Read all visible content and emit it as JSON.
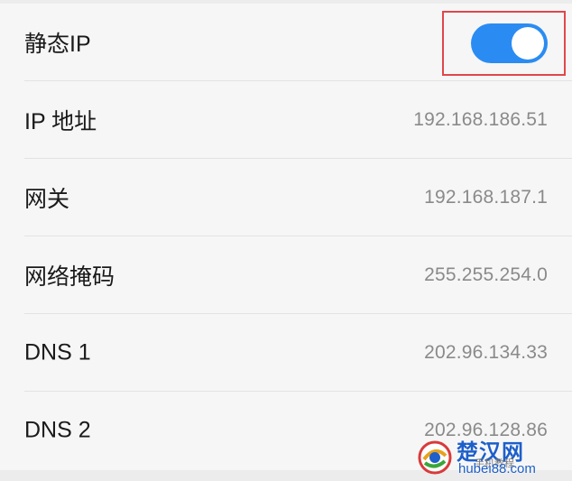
{
  "settings": {
    "rows": [
      {
        "label": "静态IP",
        "value": "",
        "type": "toggle",
        "toggle_on": true
      },
      {
        "label": "IP 地址",
        "value": "192.168.186.51"
      },
      {
        "label": "网关",
        "value": "192.168.187.1"
      },
      {
        "label": "网络掩码",
        "value": "255.255.254.0"
      },
      {
        "label": "DNS 1",
        "value": "202.96.134.33"
      },
      {
        "label": "DNS 2",
        "value": "202.96.128.86"
      }
    ]
  },
  "colors": {
    "toggle_on": "#2a8cf2",
    "highlight_box": "#e0474c",
    "label_text": "#1a1a1a",
    "value_text": "#8a8a8a",
    "background": "#f6f6f6"
  },
  "watermark": {
    "title": "楚汉网",
    "subtitle": "hubei88.com",
    "tag": "手机教程"
  }
}
